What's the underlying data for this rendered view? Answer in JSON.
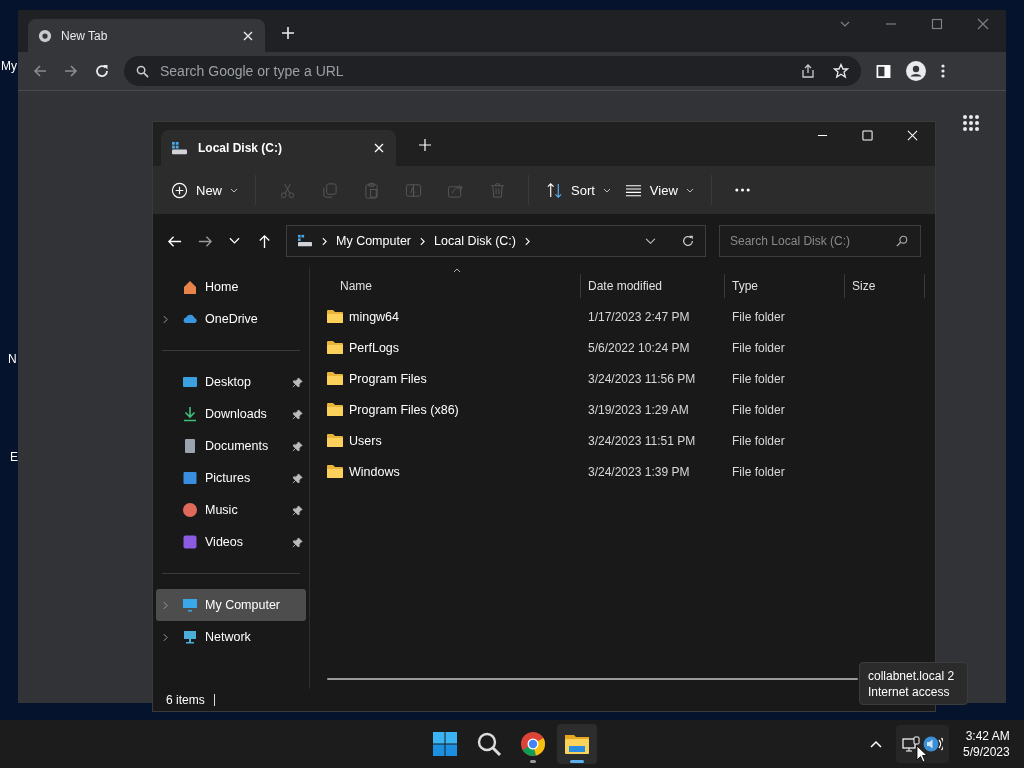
{
  "desktop": {
    "icon_labels": [
      "My",
      "N",
      "E"
    ]
  },
  "browser": {
    "tab": {
      "title": "New Tab"
    },
    "address": {
      "placeholder": "Search Google or type a URL"
    }
  },
  "explorer": {
    "tab": {
      "title": "Local Disk (C:)"
    },
    "commands": [
      {
        "kind": "new",
        "label": "New",
        "disabled": false
      },
      {
        "kind": "cut",
        "disabled": true
      },
      {
        "kind": "copy",
        "disabled": true
      },
      {
        "kind": "paste",
        "disabled": true
      },
      {
        "kind": "rename",
        "disabled": true
      },
      {
        "kind": "share",
        "disabled": true
      },
      {
        "kind": "delete",
        "disabled": true
      },
      {
        "kind": "sort",
        "label": "Sort",
        "disabled": false
      },
      {
        "kind": "view",
        "label": "View",
        "disabled": false
      },
      {
        "kind": "more",
        "disabled": false
      }
    ],
    "breadcrumb": [
      "My Computer",
      "Local Disk (C:)"
    ],
    "search": {
      "placeholder": "Search Local Disk (C:)"
    },
    "sidebar": {
      "sections": [
        [
          {
            "kind": "home",
            "label": "Home",
            "expandable": false,
            "pinned": false,
            "selected": false
          },
          {
            "kind": "cloud",
            "label": "OneDrive",
            "expandable": true,
            "pinned": false,
            "selected": false
          }
        ],
        [
          {
            "kind": "desktop",
            "label": "Desktop",
            "expandable": false,
            "pinned": true,
            "selected": false
          },
          {
            "kind": "downloads",
            "label": "Downloads",
            "expandable": false,
            "pinned": true,
            "selected": false
          },
          {
            "kind": "documents",
            "label": "Documents",
            "expandable": false,
            "pinned": true,
            "selected": false
          },
          {
            "kind": "pictures",
            "label": "Pictures",
            "expandable": false,
            "pinned": true,
            "selected": false
          },
          {
            "kind": "music",
            "label": "Music",
            "expandable": false,
            "pinned": true,
            "selected": false
          },
          {
            "kind": "videos",
            "label": "Videos",
            "expandable": false,
            "pinned": true,
            "selected": false
          }
        ],
        [
          {
            "kind": "computer",
            "label": "My Computer",
            "expandable": true,
            "pinned": false,
            "selected": true
          },
          {
            "kind": "network",
            "label": "Network",
            "expandable": true,
            "pinned": false,
            "selected": false
          }
        ]
      ]
    },
    "table": {
      "columns": [
        "Name",
        "Date modified",
        "Type",
        "Size"
      ],
      "rows": [
        {
          "name": "mingw64",
          "date": "1/17/2023 2:47 PM",
          "type": "File folder"
        },
        {
          "name": "PerfLogs",
          "date": "5/6/2022 10:24 PM",
          "type": "File folder"
        },
        {
          "name": "Program Files",
          "date": "3/24/2023 11:56 PM",
          "type": "File folder"
        },
        {
          "name": "Program Files (x86)",
          "date": "3/19/2023 1:29 AM",
          "type": "File folder"
        },
        {
          "name": "Users",
          "date": "3/24/2023 11:51 PM",
          "type": "File folder"
        },
        {
          "name": "Windows",
          "date": "3/24/2023 1:39 PM",
          "type": "File folder"
        }
      ]
    },
    "status_bar": "6 items"
  },
  "tooltip": [
    "collabnet.local 2",
    "Internet access"
  ],
  "taskbar": {
    "apps": [
      {
        "kind": "start",
        "running": false,
        "selected": false
      },
      {
        "kind": "search",
        "running": false,
        "selected": false
      },
      {
        "kind": "chrome",
        "running": true,
        "selected": false
      },
      {
        "kind": "explorer",
        "running": true,
        "selected": true
      }
    ],
    "time": "3:42 AM",
    "date": "5/9/2023"
  }
}
